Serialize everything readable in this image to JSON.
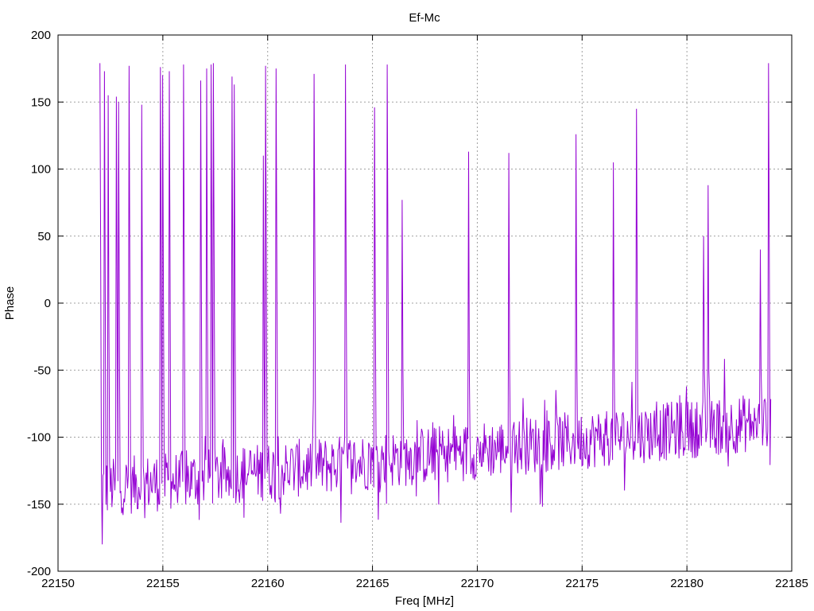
{
  "chart_data": {
    "type": "line",
    "title": "Ef-Mc",
    "xlabel": "Freq [MHz]",
    "ylabel": "Phase",
    "xlim": [
      22150,
      22185
    ],
    "ylim": [
      -200,
      200
    ],
    "x_ticks": [
      22150,
      22155,
      22160,
      22165,
      22170,
      22175,
      22180,
      22185
    ],
    "y_ticks": [
      -200,
      -150,
      -100,
      -50,
      0,
      50,
      100,
      150,
      200
    ],
    "grid": true,
    "legend": "none",
    "series_color": "#9400d3",
    "series": [
      {
        "x_start": 22152.0,
        "x_end": 22184.0,
        "baseline_start": -138,
        "baseline_end": -88,
        "noise_amplitude": 22,
        "points": 900,
        "spikes": [
          {
            "x": 22152.0,
            "y": 179
          },
          {
            "x": 22152.1,
            "y": -180
          },
          {
            "x": 22152.2,
            "y": 173
          },
          {
            "x": 22152.4,
            "y": 155
          },
          {
            "x": 22152.8,
            "y": 154
          },
          {
            "x": 22152.9,
            "y": 150
          },
          {
            "x": 22153.4,
            "y": 177
          },
          {
            "x": 22154.0,
            "y": 148
          },
          {
            "x": 22154.9,
            "y": 176
          },
          {
            "x": 22155.0,
            "y": 170
          },
          {
            "x": 22155.3,
            "y": 173
          },
          {
            "x": 22156.0,
            "y": 178
          },
          {
            "x": 22156.8,
            "y": 166
          },
          {
            "x": 22157.1,
            "y": 175
          },
          {
            "x": 22157.3,
            "y": 178
          },
          {
            "x": 22157.4,
            "y": 179
          },
          {
            "x": 22158.3,
            "y": 169
          },
          {
            "x": 22158.4,
            "y": 163
          },
          {
            "x": 22159.8,
            "y": 110
          },
          {
            "x": 22159.9,
            "y": 177
          },
          {
            "x": 22160.4,
            "y": 175
          },
          {
            "x": 22162.2,
            "y": 171
          },
          {
            "x": 22163.7,
            "y": 178
          },
          {
            "x": 22165.1,
            "y": 146
          },
          {
            "x": 22165.7,
            "y": 178
          },
          {
            "x": 22166.4,
            "y": 77
          },
          {
            "x": 22169.6,
            "y": 113
          },
          {
            "x": 22171.5,
            "y": 112
          },
          {
            "x": 22174.7,
            "y": 126
          },
          {
            "x": 22176.5,
            "y": 105
          },
          {
            "x": 22177.6,
            "y": 145
          },
          {
            "x": 22181.0,
            "y": 88
          },
          {
            "x": 22180.8,
            "y": 50
          },
          {
            "x": 22183.5,
            "y": 40
          },
          {
            "x": 22183.9,
            "y": 179
          }
        ]
      }
    ]
  }
}
